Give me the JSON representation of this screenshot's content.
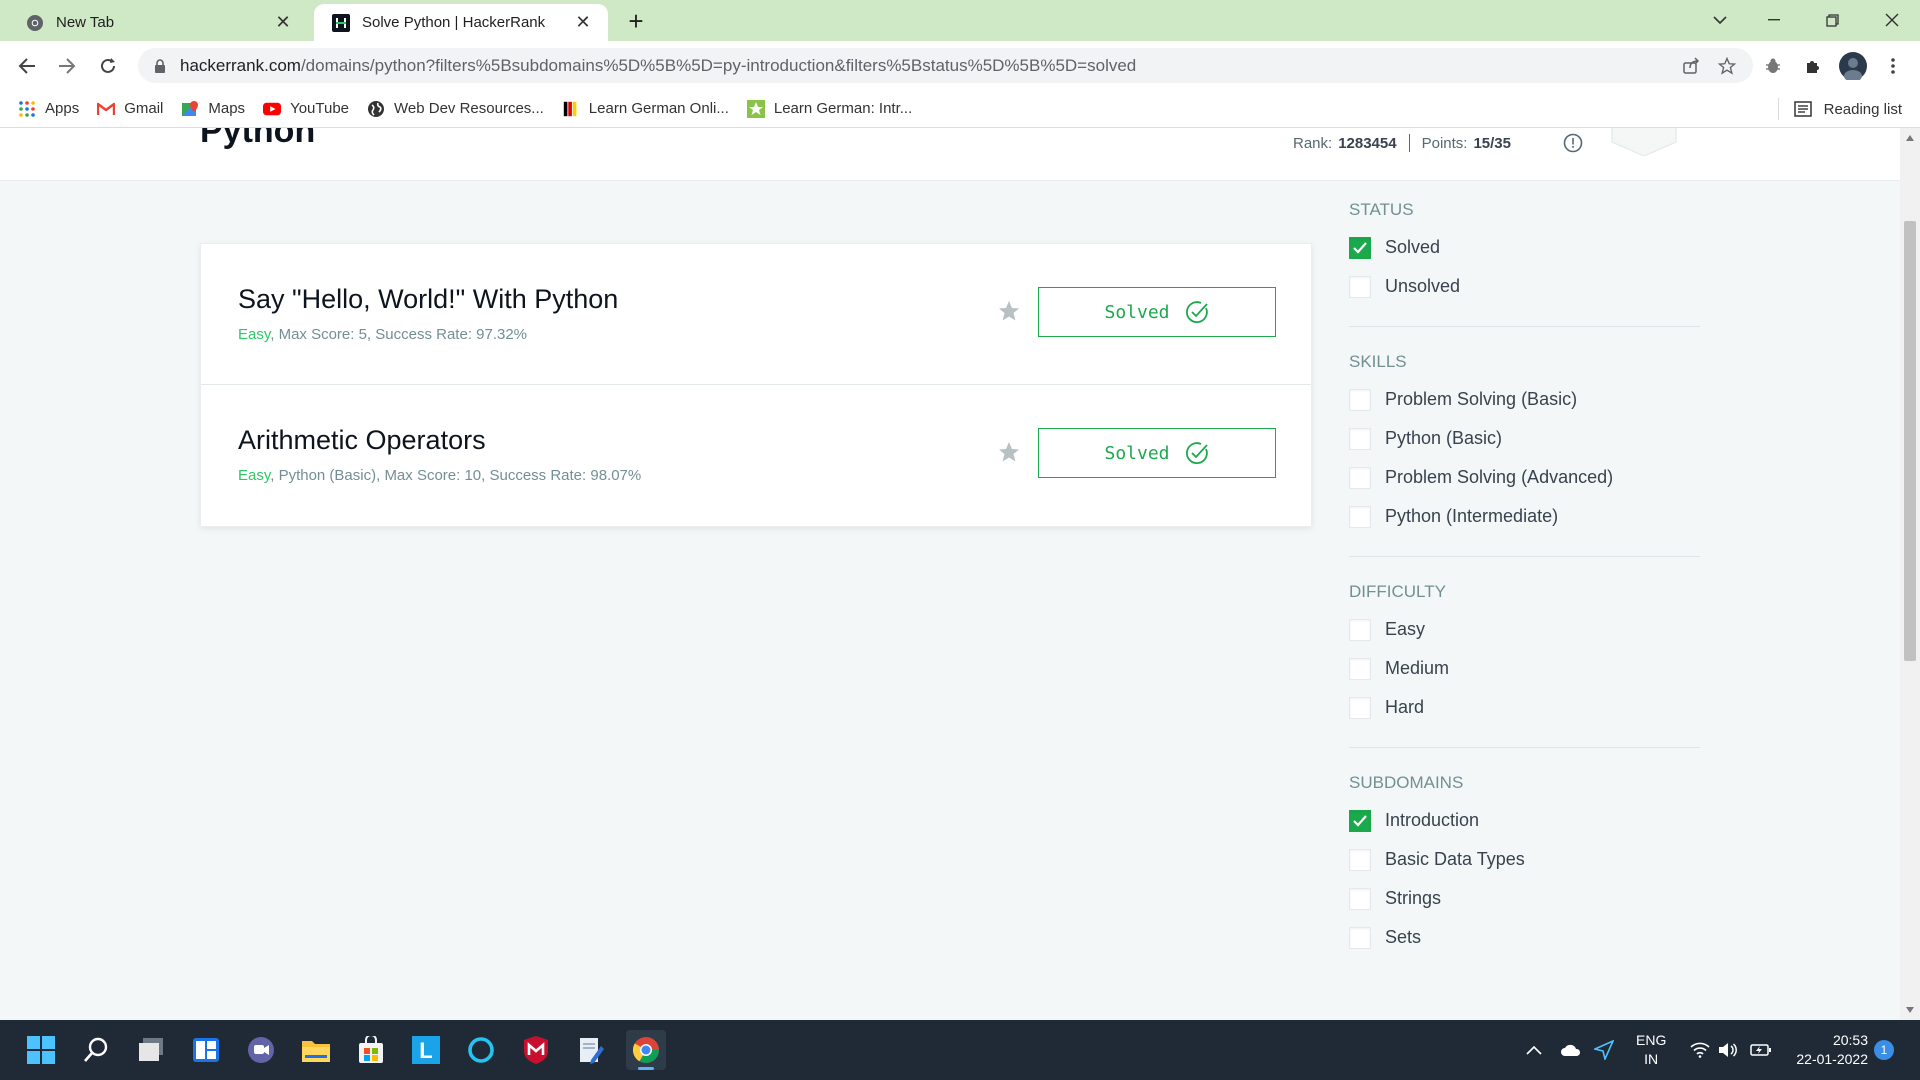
{
  "browser": {
    "tabs": [
      {
        "title": "New Tab",
        "active": false
      },
      {
        "title": "Solve Python | HackerRank",
        "active": true
      }
    ],
    "url_host": "hackerrank.com",
    "url_rest": "/domains/python?filters%5Bsubdomains%5D%5B%5D=py-introduction&filters%5Bstatus%5D%5B%5D=solved",
    "bookmarks": [
      {
        "label": "Apps",
        "icon": "apps-grid-icon"
      },
      {
        "label": "Gmail",
        "icon": "gmail-icon"
      },
      {
        "label": "Maps",
        "icon": "maps-icon"
      },
      {
        "label": "YouTube",
        "icon": "youtube-icon"
      },
      {
        "label": "Web Dev Resources...",
        "icon": "globe-icon"
      },
      {
        "label": "Learn German Onli...",
        "icon": "german-flag-icon"
      },
      {
        "label": "Learn German: Intr...",
        "icon": "star-badge-icon"
      }
    ],
    "reading_list": "Reading list"
  },
  "page": {
    "title": "Python",
    "rank_label": "Rank:",
    "rank_value": "1283454",
    "points_label": "Points:",
    "points_value": "15/35"
  },
  "challenges": [
    {
      "title": "Say \"Hello, World!\" With Python",
      "difficulty": "Easy",
      "meta": ", Max Score: 5, Success Rate: 97.32%",
      "button": "Solved"
    },
    {
      "title": "Arithmetic Operators",
      "difficulty": "Easy",
      "meta": ", Python (Basic), Max Score: 10, Success Rate: 98.07%",
      "button": "Solved"
    }
  ],
  "filters": {
    "status": {
      "heading": "STATUS",
      "items": [
        {
          "label": "Solved",
          "checked": true
        },
        {
          "label": "Unsolved",
          "checked": false
        }
      ]
    },
    "skills": {
      "heading": "SKILLS",
      "items": [
        {
          "label": "Problem Solving (Basic)",
          "checked": false
        },
        {
          "label": "Python (Basic)",
          "checked": false
        },
        {
          "label": "Problem Solving (Advanced)",
          "checked": false
        },
        {
          "label": "Python (Intermediate)",
          "checked": false
        }
      ]
    },
    "difficulty": {
      "heading": "DIFFICULTY",
      "items": [
        {
          "label": "Easy",
          "checked": false
        },
        {
          "label": "Medium",
          "checked": false
        },
        {
          "label": "Hard",
          "checked": false
        }
      ]
    },
    "subdomains": {
      "heading": "SUBDOMAINS",
      "items": [
        {
          "label": "Introduction",
          "checked": true
        },
        {
          "label": "Basic Data Types",
          "checked": false
        },
        {
          "label": "Strings",
          "checked": false
        },
        {
          "label": "Sets",
          "checked": false
        }
      ]
    }
  },
  "taskbar": {
    "lang_top": "ENG",
    "lang_bottom": "IN",
    "time": "20:53",
    "date": "22-01-2022",
    "notifications": "1"
  },
  "colors": {
    "accent_green": "#1ba94c",
    "difficulty_green": "#2ec866",
    "tabstrip": "#cfe8c5"
  }
}
